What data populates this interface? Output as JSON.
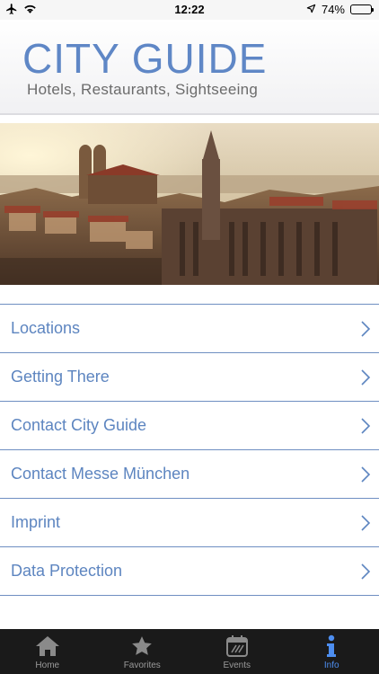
{
  "status_bar": {
    "time": "12:22",
    "battery": "74%",
    "battery_level": 0.74,
    "icons": [
      "airplane-icon",
      "wifi-icon",
      "location-arrow-icon",
      "battery-icon"
    ]
  },
  "header": {
    "title": "CITY GUIDE",
    "subtitle": "Hotels, Restaurants, Sightseeing"
  },
  "menu": {
    "items": [
      {
        "label": "Locations"
      },
      {
        "label": "Getting There"
      },
      {
        "label": "Contact City Guide"
      },
      {
        "label": "Contact Messe München"
      },
      {
        "label": "Imprint"
      },
      {
        "label": "Data Protection"
      }
    ]
  },
  "tabbar": {
    "tabs": [
      {
        "label": "Home",
        "icon": "home-icon"
      },
      {
        "label": "Favorites",
        "icon": "star-icon"
      },
      {
        "label": "Events",
        "icon": "calendar-icon"
      },
      {
        "label": "Info",
        "icon": "info-icon"
      }
    ],
    "active": "Info"
  },
  "colors": {
    "accent": "#5d85c0",
    "divider": "#6f8fc2",
    "tab_active": "#4d8ef0",
    "tab_inactive": "#9a9a9a",
    "tabbar_bg": "#1a1a1a"
  }
}
